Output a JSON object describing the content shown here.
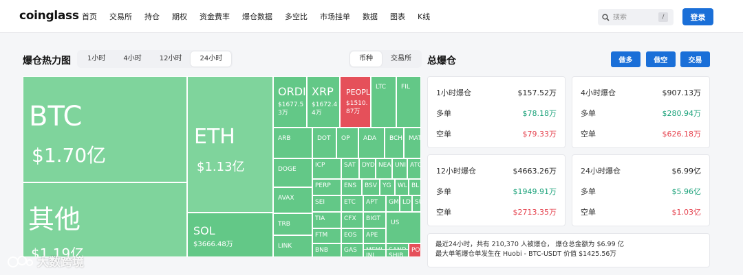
{
  "header": {
    "logo": "coinglass",
    "nav": [
      "首页",
      "交易所",
      "持仓",
      "期权",
      "资金费率",
      "爆仓数据",
      "多空比",
      "市场挂单",
      "数据",
      "图表",
      "K线"
    ],
    "search_placeholder": "搜索",
    "search_shortcut": "/",
    "login": "登录"
  },
  "heatmap": {
    "title": "爆仓热力图",
    "time_tabs": [
      "1小时",
      "4小时",
      "12小时",
      "24小时"
    ],
    "active_time_tab": "24小时",
    "group_tabs": [
      "币种",
      "交易所"
    ],
    "active_group_tab": "币种",
    "colors": {
      "green": "#63c887",
      "light_green": "#7fd49c",
      "red": "#e5505a"
    },
    "cells": [
      {
        "id": "btc",
        "symbol": "BTC",
        "amount": "$1.70亿",
        "color": "light_green"
      },
      {
        "id": "other",
        "symbol": "其他",
        "amount": "$1.19亿",
        "color": "light_green"
      },
      {
        "id": "eth",
        "symbol": "ETH",
        "amount": "$1.13亿",
        "color": "light_green"
      },
      {
        "id": "sol",
        "symbol": "SOL",
        "amount": "$3666.48万",
        "color": "green"
      },
      {
        "id": "ordi",
        "symbol": "ORDI",
        "amount": "$1677.53万",
        "color": "green"
      },
      {
        "id": "xrp",
        "symbol": "XRP",
        "amount": "$1672.44万",
        "color": "green"
      },
      {
        "id": "people",
        "symbol": "PEOPLE",
        "amount": "$1510.87万",
        "color": "red"
      },
      {
        "id": "ltc",
        "symbol": "LTC",
        "amount": "",
        "color": "green"
      },
      {
        "id": "fil",
        "symbol": "FIL",
        "amount": "",
        "color": "green"
      },
      {
        "id": "arb",
        "symbol": "ARB",
        "amount": "",
        "color": "green"
      },
      {
        "id": "dot",
        "symbol": "DOT",
        "amount": "",
        "color": "green"
      },
      {
        "id": "op",
        "symbol": "OP",
        "amount": "",
        "color": "green"
      },
      {
        "id": "ada",
        "symbol": "ADA",
        "amount": "",
        "color": "green"
      },
      {
        "id": "bch",
        "symbol": "BCH",
        "amount": "",
        "color": "green"
      },
      {
        "id": "mat",
        "symbol": "MAT",
        "amount": "",
        "color": "green"
      },
      {
        "id": "doge",
        "symbol": "DOGE",
        "amount": "",
        "color": "green"
      },
      {
        "id": "icp",
        "symbol": "ICP",
        "amount": "",
        "color": "green"
      },
      {
        "id": "sat",
        "symbol": "SAT",
        "amount": "",
        "color": "green"
      },
      {
        "id": "dyd",
        "symbol": "DYD",
        "amount": "",
        "color": "green"
      },
      {
        "id": "nea",
        "symbol": "NEA",
        "amount": "",
        "color": "green"
      },
      {
        "id": "uni",
        "symbol": "UNI",
        "amount": "",
        "color": "green"
      },
      {
        "id": "ato",
        "symbol": "ATO",
        "amount": "",
        "color": "green"
      },
      {
        "id": "perp",
        "symbol": "PERP",
        "amount": "",
        "color": "green"
      },
      {
        "id": "ens",
        "symbol": "ENS",
        "amount": "",
        "color": "green"
      },
      {
        "id": "bsv",
        "symbol": "BSV",
        "amount": "",
        "color": "green"
      },
      {
        "id": "ygg",
        "symbol": "YG",
        "amount": "",
        "color": "green"
      },
      {
        "id": "wld",
        "symbol": "WL",
        "amount": "",
        "color": "green"
      },
      {
        "id": "blur",
        "symbol": "BL",
        "amount": "",
        "color": "green"
      },
      {
        "id": "avax",
        "symbol": "AVAX",
        "amount": "",
        "color": "green"
      },
      {
        "id": "sei",
        "symbol": "SEI",
        "amount": "",
        "color": "green"
      },
      {
        "id": "etc",
        "symbol": "ETC",
        "amount": "",
        "color": "green"
      },
      {
        "id": "apt",
        "symbol": "APT",
        "amount": "",
        "color": "green"
      },
      {
        "id": "gm",
        "symbol": "GM",
        "amount": "",
        "color": "green"
      },
      {
        "id": "ld",
        "symbol": "LD",
        "amount": "",
        "color": "green"
      },
      {
        "id": "su",
        "symbol": "SU",
        "amount": "",
        "color": "green"
      },
      {
        "id": "trb",
        "symbol": "TRB",
        "amount": "",
        "color": "green"
      },
      {
        "id": "tia",
        "symbol": "TIA",
        "amount": "",
        "color": "green"
      },
      {
        "id": "cfx",
        "symbol": "CFX",
        "amount": "",
        "color": "green"
      },
      {
        "id": "bigt",
        "symbol": "BIGT",
        "amount": "",
        "color": "green"
      },
      {
        "id": "ftm",
        "symbol": "FTM",
        "amount": "",
        "color": "green"
      },
      {
        "id": "eos",
        "symbol": "EOS",
        "amount": "",
        "color": "green"
      },
      {
        "id": "ape",
        "symbol": "APE",
        "amount": "",
        "color": "green"
      },
      {
        "id": "memi",
        "symbol": "MEMI",
        "amount": "",
        "color": "green"
      },
      {
        "id": "us",
        "symbol": "US",
        "amount": "",
        "color": "green"
      },
      {
        "id": "sand",
        "symbol": "SAND",
        "amount": "",
        "color": "green"
      },
      {
        "id": "link",
        "symbol": "LINK",
        "amount": "",
        "color": "green"
      },
      {
        "id": "bnb",
        "symbol": "BNB",
        "amount": "",
        "color": "green"
      },
      {
        "id": "gas",
        "symbol": "GAS",
        "amount": "",
        "color": "green"
      },
      {
        "id": "inj",
        "symbol": "INJ",
        "amount": "",
        "color": "green"
      },
      {
        "id": "shib",
        "symbol": "SHIB",
        "amount": "",
        "color": "green"
      },
      {
        "id": "po",
        "symbol": "PO",
        "amount": "",
        "color": "red"
      }
    ]
  },
  "liquidation": {
    "title": "总爆仓",
    "buttons": [
      "做多",
      "做空",
      "交易"
    ],
    "cards": [
      {
        "id": "1h",
        "rows": [
          {
            "label": "1小时爆仓",
            "value": "$157.52万",
            "tone": "plain"
          },
          {
            "label": "多单",
            "value": "$78.18万",
            "tone": "green"
          },
          {
            "label": "空单",
            "value": "$79.33万",
            "tone": "red"
          }
        ]
      },
      {
        "id": "4h",
        "rows": [
          {
            "label": "4小时爆仓",
            "value": "$907.13万",
            "tone": "plain"
          },
          {
            "label": "多单",
            "value": "$280.94万",
            "tone": "green"
          },
          {
            "label": "空单",
            "value": "$626.18万",
            "tone": "red"
          }
        ]
      },
      {
        "id": "12h",
        "rows": [
          {
            "label": "12小时爆仓",
            "value": "$4663.26万",
            "tone": "plain"
          },
          {
            "label": "多单",
            "value": "$1949.91万",
            "tone": "green"
          },
          {
            "label": "空单",
            "value": "$2713.35万",
            "tone": "red"
          }
        ]
      },
      {
        "id": "24h",
        "rows": [
          {
            "label": "24小时爆仓",
            "value": "$6.99亿",
            "tone": "plain"
          },
          {
            "label": "多单",
            "value": "$5.96亿",
            "tone": "green"
          },
          {
            "label": "空单",
            "value": "$1.03亿",
            "tone": "red"
          }
        ]
      }
    ],
    "summary_line1": "最近24小时，共有 210,370 人被爆仓， 爆仓总金额为 $6.99 亿",
    "summary_line2": "最大单笔爆仓单发生在 Huobi - BTC-USDT 价值 $1425.56万"
  },
  "watermark": "大数跨境"
}
